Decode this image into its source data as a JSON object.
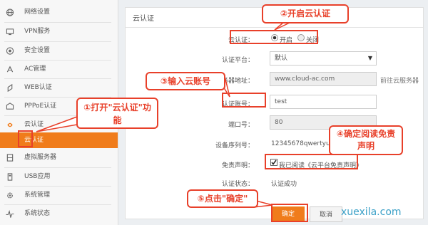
{
  "sidebar": {
    "items": [
      {
        "label": "网络设置",
        "icon": "globe-icon"
      },
      {
        "label": "VPN服务",
        "icon": "vpn-icon"
      },
      {
        "label": "安全设置",
        "icon": "shield-icon"
      },
      {
        "label": "AC管理",
        "icon": "ac-icon"
      },
      {
        "label": "WEB认证",
        "icon": "web-auth-icon"
      },
      {
        "label": "PPPoE认证",
        "icon": "pppoe-icon"
      },
      {
        "label": "云认证",
        "icon": "cloud-icon"
      },
      {
        "label": "虚拟服务器",
        "icon": "server-icon"
      },
      {
        "label": "USB应用",
        "icon": "usb-icon"
      },
      {
        "label": "系统管理",
        "icon": "gear-icon"
      },
      {
        "label": "系统状态",
        "icon": "pulse-icon"
      }
    ],
    "sub_item": "云认证"
  },
  "main": {
    "title": "云认证",
    "form": {
      "cloud_auth_label": "云认证：",
      "radio_on": "开启",
      "radio_off": "关闭",
      "platform_label": "认证平台：",
      "platform_value": "默认",
      "server_label": "服务器地址：",
      "server_value": "www.cloud-ac.com",
      "server_link": "前往云服务器",
      "account_label": "认证账号：",
      "account_value": "test",
      "port_label": "端口号：",
      "port_value": "80",
      "serial_label": "设备序列号：",
      "serial_value": "12345678qwertyuiop",
      "disclaimer_label": "免责声明：",
      "disclaimer_text": "我已阅读《云平台免责声明》",
      "status_label": "认证状态：",
      "status_value": "认证成功"
    },
    "confirm_label": "确定",
    "cancel_label": "取消"
  },
  "callouts": {
    "c1": "①打开\"云认证\"功能",
    "c2": "②开启云认证",
    "c3": "③输入云账号",
    "c4": "④确定阅读免责声明",
    "c5": "⑤点击\"确定\""
  },
  "watermark": "xuexila.com",
  "colors": {
    "accent": "#f07c1b",
    "callout": "#e8402a",
    "watermark": "#3aa0c7"
  }
}
